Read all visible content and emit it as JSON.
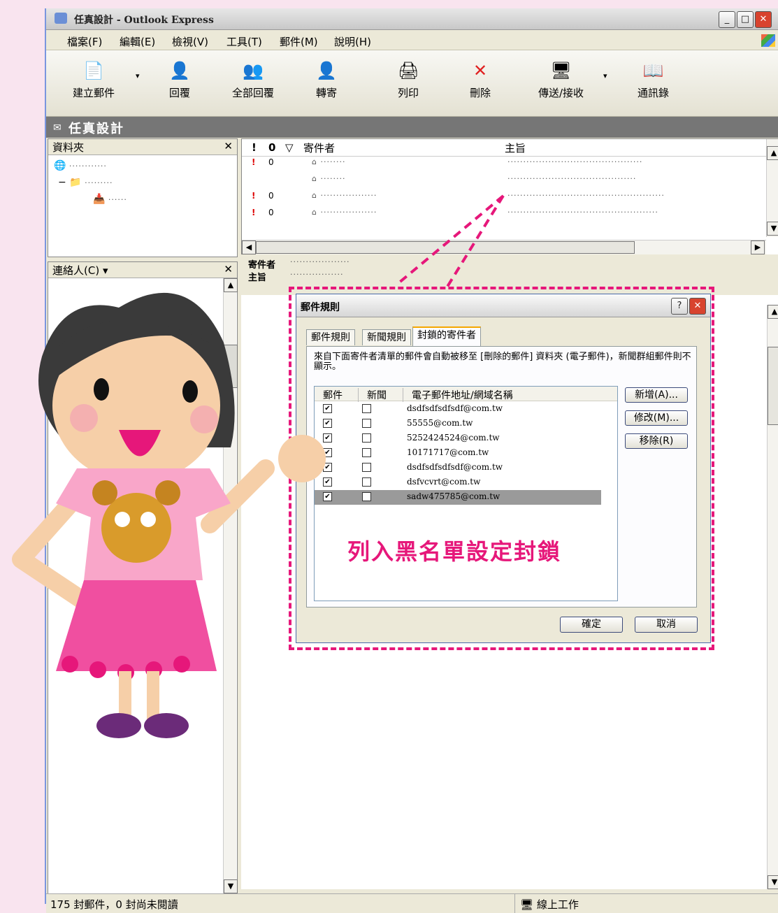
{
  "window": {
    "title": "任真設計 - Outlook Express",
    "controls": [
      "_",
      "□",
      "✕"
    ]
  },
  "menu": [
    "檔案(F)",
    "編輯(E)",
    "檢視(V)",
    "工具(T)",
    "郵件(M)",
    "說明(H)"
  ],
  "toolbar": [
    {
      "label": "建立郵件",
      "icon": "new-mail-icon"
    },
    {
      "label": "回覆",
      "icon": "reply-icon"
    },
    {
      "label": "全部回覆",
      "icon": "reply-all-icon"
    },
    {
      "label": "轉寄",
      "icon": "forward-icon"
    },
    {
      "label": "列印",
      "icon": "print-icon"
    },
    {
      "label": "刪除",
      "icon": "delete-icon"
    },
    {
      "label": "傳送/接收",
      "icon": "send-receive-icon"
    },
    {
      "label": "通訊錄",
      "icon": "address-book-icon"
    }
  ],
  "folder_bar": {
    "title": "任真設計"
  },
  "folders_pane": {
    "title": "資料夾",
    "close": "✕"
  },
  "contacts_pane": {
    "title": "連絡人(C) ▾",
    "close": "✕"
  },
  "message_list": {
    "columns": [
      "!",
      "0",
      "▽",
      "寄件者",
      "主旨"
    ]
  },
  "preview": {
    "header_from_label": "寄件者",
    "header_subject_label": "主旨"
  },
  "dialog": {
    "title": "郵件規則",
    "help": "?",
    "close": "✕",
    "tabs": [
      "郵件規則",
      "新聞規則",
      "封鎖的寄件者"
    ],
    "description": "來自下面寄件者清單的郵件會自動被移至 [刪除的郵件] 資料夾 (電子郵件)，新聞群組郵件則不顯示。",
    "list_headers": [
      "郵件",
      "新聞",
      "電子郵件地址/網域名稱"
    ],
    "blocked": [
      {
        "address": "dsdfsdfsdfsdf@com.tw",
        "mail": true,
        "news": false
      },
      {
        "address": "55555@com.tw",
        "mail": true,
        "news": false
      },
      {
        "address": "5252424524@com.tw",
        "mail": true,
        "news": false
      },
      {
        "address": "10171717@com.tw",
        "mail": true,
        "news": false
      },
      {
        "address": "dsdfsdfsdfsdf@com.tw",
        "mail": true,
        "news": false
      },
      {
        "address": "dsfvcvrt@com.tw",
        "mail": true,
        "news": false
      },
      {
        "address": "sadw475785@com.tw",
        "mail": true,
        "news": false
      }
    ],
    "buttons": {
      "add": "新增(A)...",
      "modify": "修改(M)...",
      "remove": "移除(R)",
      "ok": "確定",
      "cancel": "取消"
    }
  },
  "callout": "列入黑名單設定封鎖",
  "status": {
    "left": "175 封郵件，0 封尚未閱讀",
    "right": "線上工作"
  },
  "colors": {
    "accent": "#e6177a",
    "folder_bar": "#767676",
    "chrome": "#ece9d8"
  }
}
